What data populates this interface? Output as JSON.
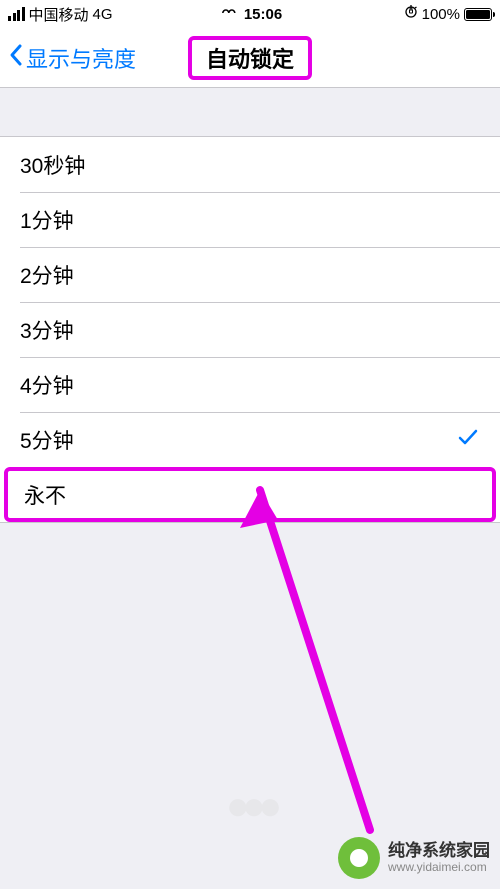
{
  "statusbar": {
    "carrier": "中国移动",
    "network": "4G",
    "time": "15:06",
    "battery_pct": "100%",
    "orientation_lock": "⊕"
  },
  "nav": {
    "back_label": "显示与亮度",
    "title": "自动锁定"
  },
  "options": [
    {
      "label": "30秒钟",
      "selected": false,
      "highlight": false
    },
    {
      "label": "1分钟",
      "selected": false,
      "highlight": false
    },
    {
      "label": "2分钟",
      "selected": false,
      "highlight": false
    },
    {
      "label": "3分钟",
      "selected": false,
      "highlight": false
    },
    {
      "label": "4分钟",
      "selected": false,
      "highlight": false
    },
    {
      "label": "5分钟",
      "selected": true,
      "highlight": false
    },
    {
      "label": "永不",
      "selected": false,
      "highlight": true
    }
  ],
  "watermark": {
    "title": "纯净系统家园",
    "url": "www.yidaimei.com"
  },
  "annotation": {
    "color": "#e400e4"
  }
}
